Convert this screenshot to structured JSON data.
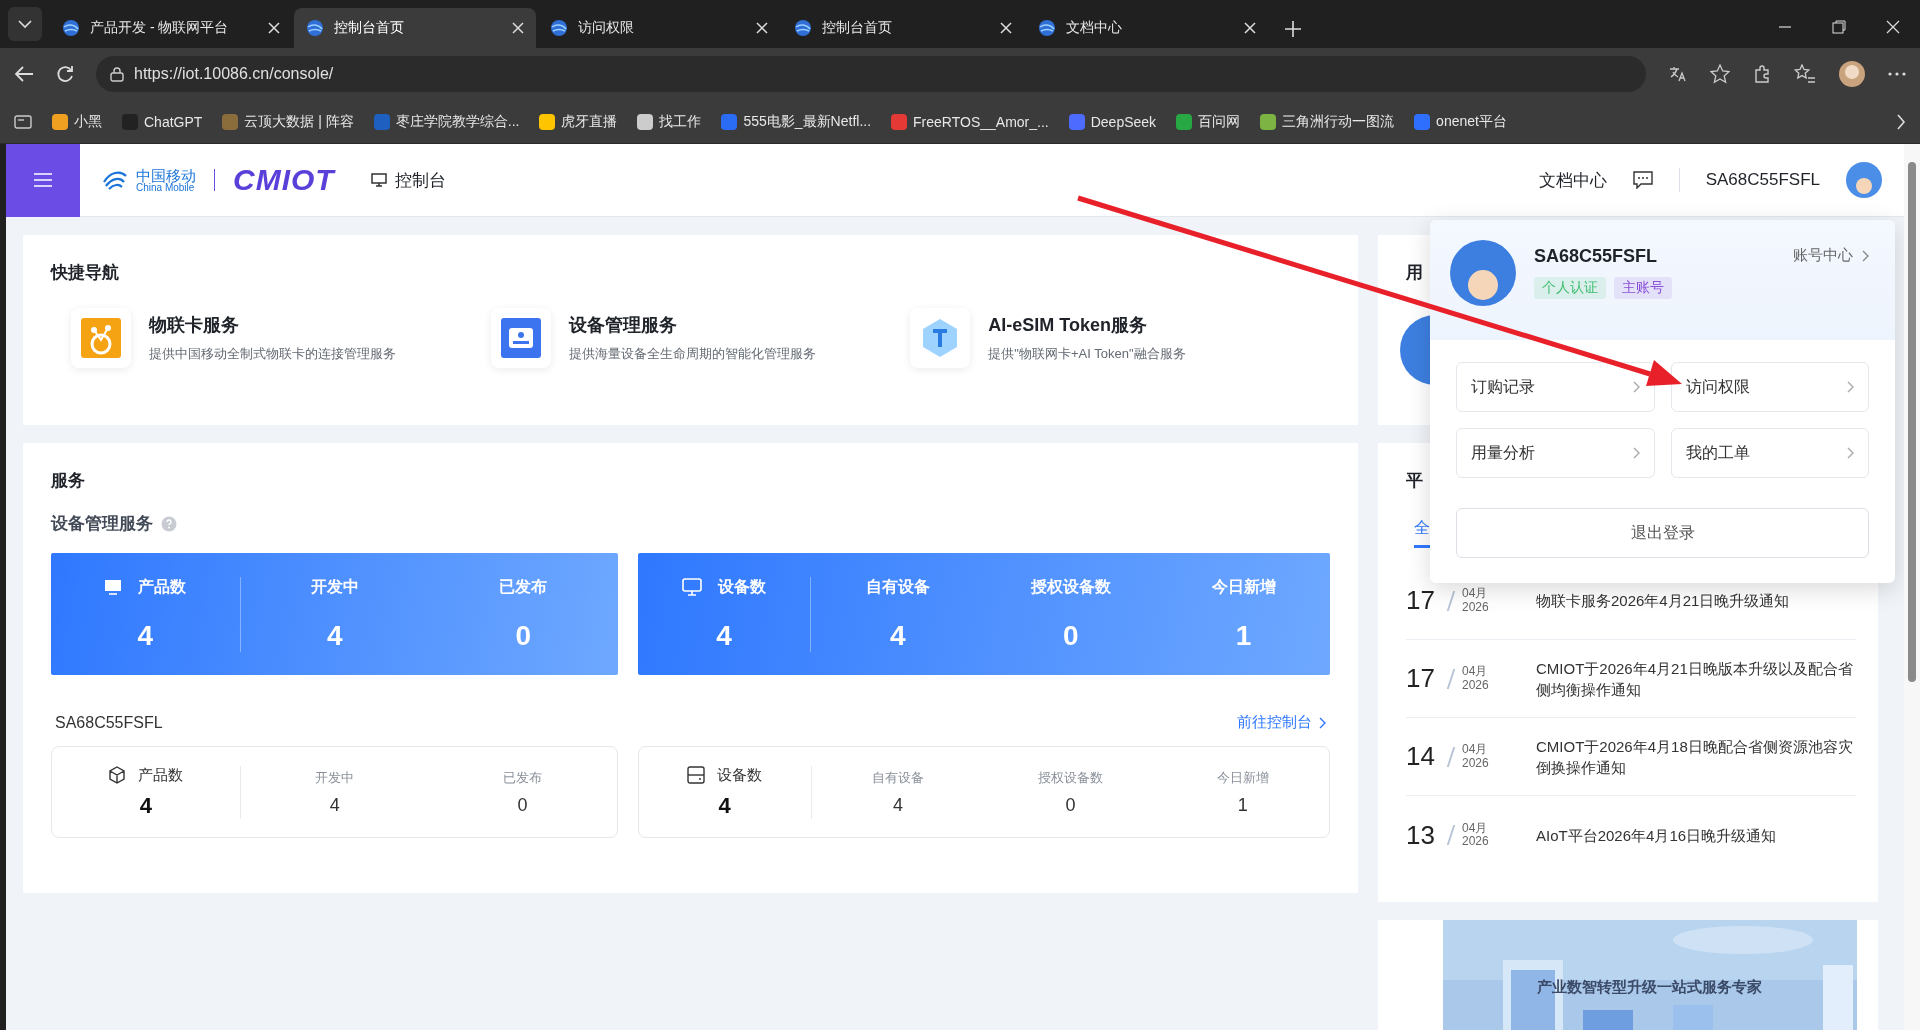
{
  "browser": {
    "tabs": [
      {
        "title": "产品开发 - 物联网平台",
        "selected": false
      },
      {
        "title": "控制台首页",
        "selected": true
      },
      {
        "title": "访问权限",
        "selected": false
      },
      {
        "title": "控制台首页",
        "selected": false
      },
      {
        "title": "文档中心",
        "selected": false
      }
    ],
    "address": "https://iot.10086.cn/console/",
    "bookmarks": [
      {
        "label": "小黑",
        "color": "#f0a020"
      },
      {
        "label": "ChatGPT",
        "color": "#222222"
      },
      {
        "label": "云顶大数据 | 阵容",
        "color": "#8a6d3b"
      },
      {
        "label": "枣庄学院教学综合...",
        "color": "#1f5fbf"
      },
      {
        "label": "虎牙直播",
        "color": "#ffc400"
      },
      {
        "label": "找工作",
        "color": "#cccccc"
      },
      {
        "label": "555电影_最新Netfl...",
        "color": "#2a6df4"
      },
      {
        "label": "FreeRTOS__Amor_...",
        "color": "#e53935"
      },
      {
        "label": "DeepSeek",
        "color": "#4d6bfe"
      },
      {
        "label": "百问网",
        "color": "#27a845"
      },
      {
        "label": "三角洲行动一图流",
        "color": "#7cb342"
      },
      {
        "label": "onenet平台",
        "color": "#2f6fff"
      }
    ]
  },
  "header": {
    "logo_cn": "中国移动",
    "logo_en": "China Mobile",
    "brand": "CMIOT",
    "console": "控制台",
    "docs": "文档中心",
    "username": "SA68C55FSFL"
  },
  "quick_nav": {
    "title": "快捷导航",
    "items": [
      {
        "kind": "card",
        "title": "物联卡服务",
        "desc": "提供中国移动全制式物联卡的连接管理服务"
      },
      {
        "kind": "device",
        "title": "设备管理服务",
        "desc": "提供海量设备全生命周期的智能化管理服务"
      },
      {
        "kind": "token",
        "title": "AI-eSIM Token服务",
        "desc": "提供\"物联网卡+AI Token\"融合服务"
      }
    ]
  },
  "services": {
    "title": "服务",
    "subtitle": "设备管理服务",
    "summary": [
      {
        "kind": "product",
        "cells": [
          {
            "label": "产品数",
            "value": "4"
          },
          {
            "label": "开发中",
            "value": "4"
          },
          {
            "label": "已发布",
            "value": "0"
          }
        ]
      },
      {
        "kind": "device",
        "cells": [
          {
            "label": "设备数",
            "value": "4"
          },
          {
            "label": "自有设备",
            "value": "4"
          },
          {
            "label": "授权设备数",
            "value": "0"
          },
          {
            "label": "今日新增",
            "value": "1"
          }
        ]
      }
    ],
    "account": "SA68C55FSFL",
    "link": "前往控制台",
    "details": [
      {
        "kind": "product",
        "cells": [
          {
            "label": "产品数",
            "value": "4"
          },
          {
            "label": "开发中",
            "value": "4"
          },
          {
            "label": "已发布",
            "value": "0"
          }
        ]
      },
      {
        "kind": "device",
        "cells": [
          {
            "label": "设备数",
            "value": "4"
          },
          {
            "label": "自有设备",
            "value": "4"
          },
          {
            "label": "授权设备数",
            "value": "0"
          },
          {
            "label": "今日新增",
            "value": "1"
          }
        ]
      }
    ]
  },
  "user_card": {
    "title": "用"
  },
  "notices": {
    "title": "平",
    "tabs": [
      {
        "label": "全",
        "selected": true
      }
    ],
    "items": [
      {
        "day": "17",
        "month": "04月",
        "year": "2026",
        "text": "物联卡服务2026年4月21日晚升级通知"
      },
      {
        "day": "17",
        "month": "04月",
        "year": "2026",
        "text": "CMIOT于2026年4月21日晚版本升级以及配合省侧均衡操作通知"
      },
      {
        "day": "14",
        "month": "04月",
        "year": "2026",
        "text": "CMIOT于2026年4月18日晚配合省侧资源池容灾倒换操作通知"
      },
      {
        "day": "13",
        "month": "04月",
        "year": "2026",
        "text": "AIoT平台2026年4月16日晚升级通知"
      }
    ]
  },
  "banner": {
    "kind": "picture",
    "caption": "产业数智转型升级一站式服务专家"
  },
  "popup": {
    "username": "SA68C55FSFL",
    "account_center": "账号中心",
    "tags": [
      {
        "label": "个人认证",
        "color": "#3fbf6f"
      },
      {
        "label": "主账号",
        "color": "#8a4fd8"
      }
    ],
    "actions": [
      "订购记录",
      "访问权限",
      "用量分析",
      "我的工单"
    ],
    "logout": "退出登录"
  }
}
